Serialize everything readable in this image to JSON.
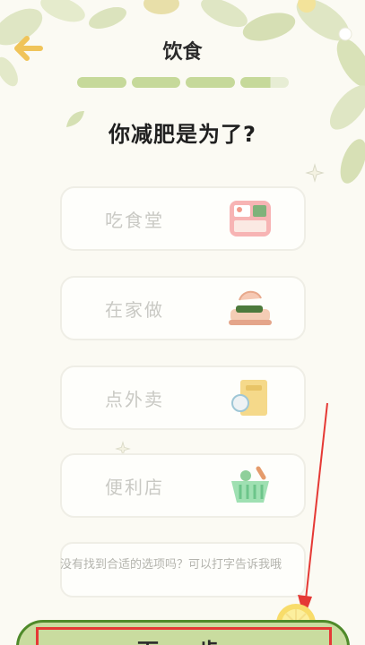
{
  "header": {
    "title": "饮食",
    "back_icon": "arrow-left-icon",
    "progress_steps": 4,
    "progress_fraction": 0.9
  },
  "question": "你减肥是为了?",
  "options": [
    {
      "label": "吃食堂",
      "icon": "lunchbox-icon"
    },
    {
      "label": "在家做",
      "icon": "cooking-pot-icon"
    },
    {
      "label": "点外卖",
      "icon": "takeout-bag-icon"
    },
    {
      "label": "便利店",
      "icon": "shopping-basket-icon"
    }
  ],
  "custom_input": {
    "placeholder": "没有找到合适的选项吗？可以打字告诉我哦"
  },
  "next_button": {
    "label": "下一步"
  },
  "colors": {
    "accent_green": "#c6d99a",
    "button_border": "#4f8a2a",
    "annotation_red": "#e53935",
    "background": "#fbfaf3"
  }
}
